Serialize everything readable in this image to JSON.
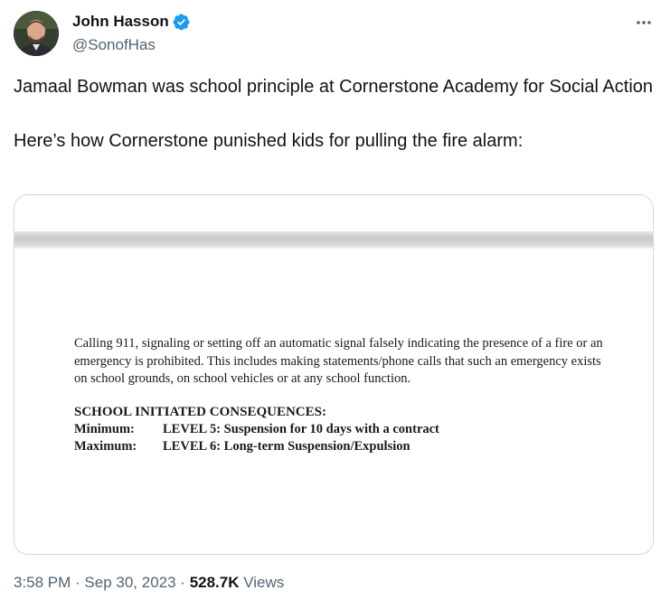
{
  "author": {
    "display_name": "John Hasson",
    "handle": "@SonofHas",
    "verified": true
  },
  "icons": {
    "verified": "verified-badge-icon",
    "more": "more-horizontal-icon"
  },
  "colors": {
    "verified_blue": "#1d9bf0",
    "secondary_text": "#536471"
  },
  "tweet": {
    "paragraph_1": "Jamaal Bowman was school principle at Cornerstone Academy for Social Action",
    "paragraph_2": "Here’s how Cornerstone punished kids for pulling the fire alarm:"
  },
  "media_document": {
    "paragraph": "Calling 911, signaling or setting off an automatic signal falsely indicating the presence of a fire or an emergency is prohibited. This includes making statements/phone calls that such an emergency exists on school grounds, on school vehicles or at any school function.",
    "heading": "SCHOOL INITIATED CONSEQUENCES:",
    "rows": [
      {
        "label": "Minimum:",
        "value": "LEVEL 5: Suspension for 10 days with a contract"
      },
      {
        "label": "Maximum:",
        "value": "LEVEL 6: Long-term Suspension/Expulsion"
      }
    ]
  },
  "meta": {
    "time": "3:58 PM",
    "separator": " · ",
    "date": "Sep 30, 2023",
    "separator2": " · ",
    "views_count": "528.7K",
    "views_label": " Views"
  }
}
